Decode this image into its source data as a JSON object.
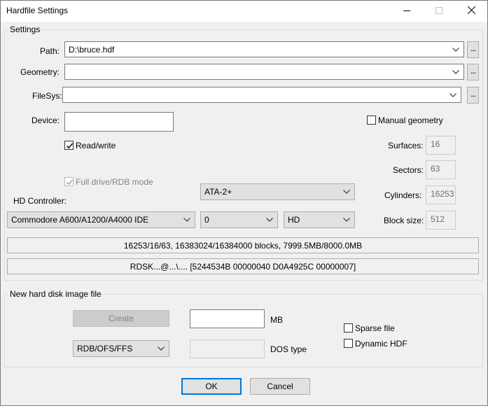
{
  "window": {
    "title": "Hardfile Settings",
    "min_icon": "minimize-icon",
    "max_icon": "maximize-icon",
    "close_icon": "close-icon"
  },
  "settings": {
    "legend": "Settings",
    "path": {
      "label": "Path:",
      "value": "D:\\bruce.hdf",
      "browse": "..."
    },
    "geometry": {
      "label": "Geometry:",
      "value": "",
      "browse": "..."
    },
    "filesys": {
      "label": "FileSys:",
      "value": "",
      "browse": "..."
    },
    "device": {
      "label": "Device:",
      "value": ""
    },
    "manual_geometry": {
      "label": "Manual geometry",
      "checked": false
    },
    "read_write": {
      "label": "Read/write",
      "checked": true
    },
    "full_drive": {
      "label": "Full drive/RDB mode",
      "checked": true,
      "disabled": true
    },
    "surfaces": {
      "label": "Surfaces:",
      "value": "16"
    },
    "sectors": {
      "label": "Sectors:",
      "value": "63"
    },
    "cylinders": {
      "label": "Cylinders:",
      "value": "16253"
    },
    "block_size": {
      "label": "Block size:",
      "value": "512"
    },
    "hd_controller": {
      "label": "HD Controller:",
      "controller": "Commodore A600/A1200/A4000 IDE",
      "unit": "0",
      "type": "HD",
      "ata": "ATA-2+"
    },
    "info_geometry": "16253/16/63, 16383024/16384000 blocks, 7999.5MB/8000.0MB",
    "info_rdsk": "RDSK...@...\\.... [5244534B 00000040 D0A4925C 00000007]"
  },
  "new_image": {
    "legend": "New hard disk image file",
    "create_label": "Create",
    "size_value": "",
    "size_unit": "MB",
    "fs_type": "RDB/OFS/FFS",
    "dos_type_value": "",
    "dos_type_label": "DOS type",
    "sparse": {
      "label": "Sparse file",
      "checked": false
    },
    "dynamic": {
      "label": "Dynamic HDF",
      "checked": false
    }
  },
  "buttons": {
    "ok": "OK",
    "cancel": "Cancel"
  },
  "colors": {
    "default_button_border": "#0078d7",
    "dialog_bg": "#f0f0f0"
  }
}
